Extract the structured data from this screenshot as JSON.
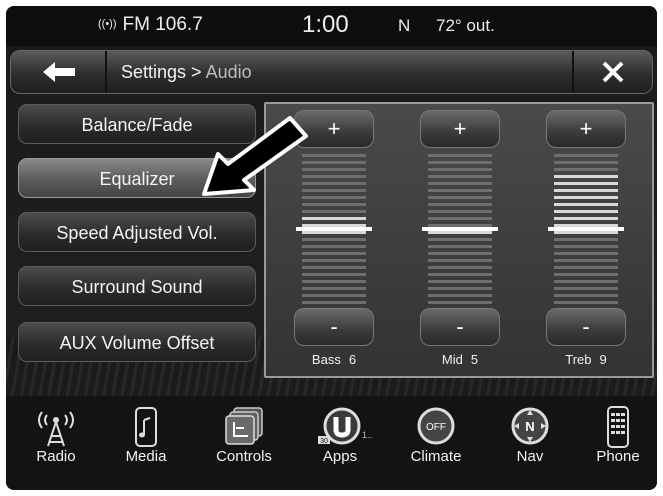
{
  "status": {
    "radio": "FM 106.7",
    "time": "1:00",
    "compass": "N",
    "temperature": "72° out."
  },
  "header": {
    "breadcrumb_parent": "Settings > ",
    "breadcrumb_current": "Audio"
  },
  "menu": [
    {
      "label": "Balance/Fade",
      "active": false
    },
    {
      "label": "Equalizer",
      "active": true
    },
    {
      "label": "Speed Adjusted Vol.",
      "active": false
    },
    {
      "label": "Surround Sound",
      "active": false
    },
    {
      "label": "AUX Volume Offset",
      "active": false
    }
  ],
  "equalizer": {
    "plus_label": "+",
    "minus_label": "-",
    "bands": [
      {
        "name": "Bass",
        "value": "6",
        "level": 6
      },
      {
        "name": "Mid",
        "value": "5",
        "level": 5
      },
      {
        "name": "Treb",
        "value": "9",
        "level": 9
      }
    ]
  },
  "dock": [
    {
      "label": "Radio",
      "icon": "radio-tower-icon"
    },
    {
      "label": "Media",
      "icon": "media-phone-icon"
    },
    {
      "label": "Controls",
      "icon": "seat-heat-icon"
    },
    {
      "label": "Apps",
      "icon": "apps-u-icon",
      "badge": "30",
      "extra": "1.."
    },
    {
      "label": "Climate",
      "icon": "climate-off-icon",
      "glyph": "OFF"
    },
    {
      "label": "Nav",
      "icon": "compass-n-icon",
      "glyph": "N"
    },
    {
      "label": "Phone",
      "icon": "phone-keypad-icon"
    }
  ]
}
